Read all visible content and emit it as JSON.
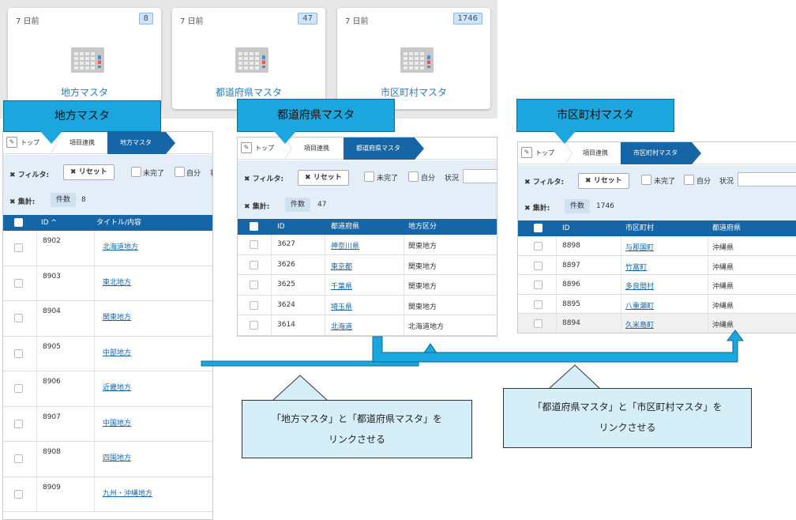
{
  "cards": [
    {
      "date": "7 日前",
      "count": "8",
      "title": "地方マスタ"
    },
    {
      "date": "7 日前",
      "count": "47",
      "title": "都道府県マスタ"
    },
    {
      "date": "7 日前",
      "count": "1746",
      "title": "市区町村マスタ"
    }
  ],
  "callouts": {
    "left": "地方マスタ",
    "mid": "都道府県マスタ",
    "right": "市区町村マスタ"
  },
  "panel_left": {
    "breadcrumb": [
      "トップ",
      "項目連携",
      "地方マスタ"
    ],
    "filter_label": "フィルタ:",
    "reset": "リセット",
    "chk1": "未完了",
    "chk2": "自分",
    "status_label": "状",
    "total_label": "集計:",
    "count_chip": "件数",
    "count": "8",
    "headers": [
      "ID ^",
      "タイトル/内容"
    ],
    "rows": [
      {
        "id": "8902",
        "name": "北海道地方"
      },
      {
        "id": "8903",
        "name": "東北地方"
      },
      {
        "id": "8904",
        "name": "関東地方"
      },
      {
        "id": "8905",
        "name": "中部地方"
      },
      {
        "id": "8906",
        "name": "近畿地方"
      },
      {
        "id": "8907",
        "name": "中国地方"
      },
      {
        "id": "8908",
        "name": "四国地方"
      },
      {
        "id": "8909",
        "name": "九州・沖縄地方"
      }
    ]
  },
  "panel_mid": {
    "breadcrumb": [
      "トップ",
      "項目連携",
      "都道府県マスタ"
    ],
    "filter_label": "フィルタ:",
    "reset": "リセット",
    "chk1": "未完了",
    "chk2": "自分",
    "status_label": "状況",
    "total_label": "集計:",
    "count_chip": "件数",
    "count": "47",
    "headers": [
      "ID",
      "都道府県",
      "地方区分"
    ],
    "rows": [
      {
        "id": "3627",
        "name": "神奈川県",
        "region": "関東地方"
      },
      {
        "id": "3626",
        "name": "東京都",
        "region": "関東地方"
      },
      {
        "id": "3625",
        "name": "千葉県",
        "region": "関東地方"
      },
      {
        "id": "3624",
        "name": "埼玉県",
        "region": "関東地方"
      },
      {
        "id": "3614",
        "name": "北海道",
        "region": "北海道地方"
      }
    ]
  },
  "panel_right": {
    "breadcrumb": [
      "トップ",
      "項目連携",
      "市区町村マスタ"
    ],
    "filter_label": "フィルタ:",
    "reset": "リセット",
    "chk1": "未完了",
    "chk2": "自分",
    "status_label": "状況",
    "total_label": "集計:",
    "count_chip": "件数",
    "count": "1746",
    "headers": [
      "ID",
      "市区町村",
      "都道府県"
    ],
    "rows": [
      {
        "id": "8898",
        "name": "与那国町",
        "pref": "沖縄県"
      },
      {
        "id": "8897",
        "name": "竹富町",
        "pref": "沖縄県"
      },
      {
        "id": "8896",
        "name": "多良間村",
        "pref": "沖縄県"
      },
      {
        "id": "8895",
        "name": "八重瀬町",
        "pref": "沖縄県"
      },
      {
        "id": "8894",
        "name": "久米島町",
        "pref": "沖縄県"
      }
    ]
  },
  "notes": {
    "left_line1": "「地方マスタ」と「都道府県マスタ」を",
    "left_line2": "リンクさせる",
    "right_line1": "「都道府県マスタ」と「市区町村マスタ」を",
    "right_line2": "リンクさせる"
  },
  "colors": {
    "header_blue": "#1565a7",
    "callout_blue": "#1ba6df",
    "link_blue": "#1565a7",
    "note_bg": "#d6eef8"
  },
  "icons": [
    "calendar-grid-icon",
    "pencil-icon",
    "close-x-icon",
    "arrow-connector-icon"
  ]
}
